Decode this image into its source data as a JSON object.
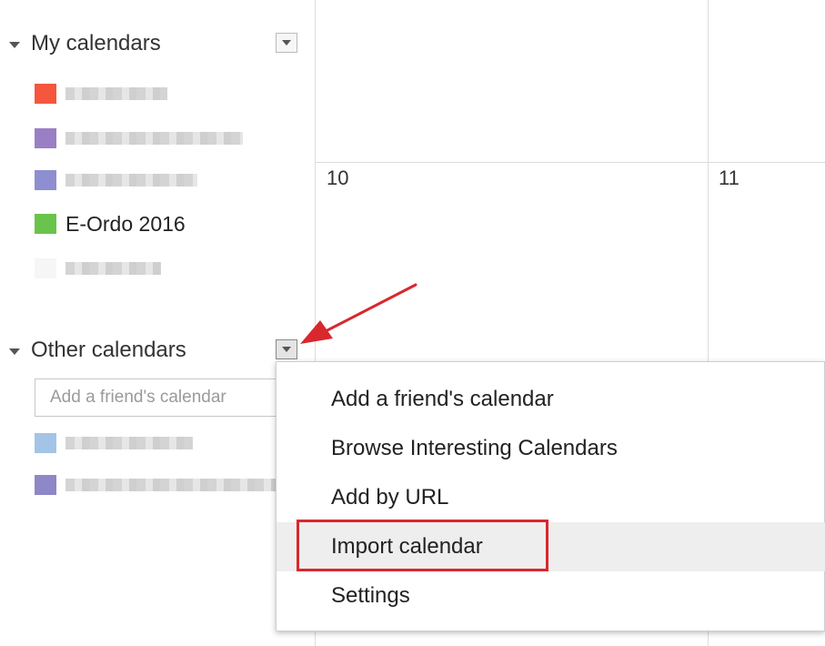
{
  "sidebar": {
    "my_calendars": {
      "title": "My calendars",
      "items": [
        {
          "label": "",
          "color": "#f4573d",
          "blurred": true,
          "blur_width": 112
        },
        {
          "label": "",
          "color": "#9a7fc4",
          "blurred": true,
          "blur_width": 195
        },
        {
          "label": "",
          "color": "#8e8fd0",
          "blurred": true,
          "blur_width": 145
        },
        {
          "label": "E-Ordo 2016",
          "color": "#6ac34a",
          "blurred": false
        },
        {
          "label": "",
          "color": "#f6f6f6",
          "blurred": true,
          "blur_width": 105
        }
      ]
    },
    "other_calendars": {
      "title": "Other calendars",
      "friend_input_placeholder": "Add a friend's calendar",
      "items": [
        {
          "label": "",
          "color": "#a3c4e6",
          "blurred": true,
          "blur_width": 140
        },
        {
          "label": "",
          "color": "#8e87c8",
          "blurred": true,
          "blur_width": 270
        }
      ]
    }
  },
  "calendar_grid": {
    "day_numbers": [
      "10",
      "11"
    ]
  },
  "menu": {
    "items": [
      {
        "label": "Add a friend's calendar"
      },
      {
        "label": "Browse Interesting Calendars"
      },
      {
        "label": "Add by URL"
      },
      {
        "label": "Import calendar",
        "highlighted": true
      },
      {
        "label": "Settings"
      }
    ]
  },
  "colors": {
    "accent_red": "#d9272e",
    "grid_line": "#dcdcdc",
    "menu_hover": "#eeeeee"
  }
}
